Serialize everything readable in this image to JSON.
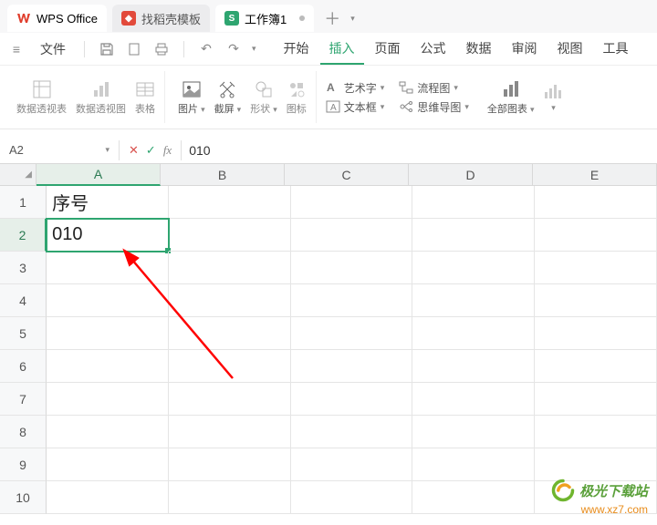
{
  "tabs": {
    "wps": "WPS Office",
    "t1": "找稻壳模板",
    "t2": "工作簿1"
  },
  "menu": {
    "file": "文件",
    "items": [
      "开始",
      "插入",
      "页面",
      "公式",
      "数据",
      "审阅",
      "视图",
      "工具"
    ],
    "activeIndex": 1
  },
  "ribbon": {
    "pivotTable": "数据透视表",
    "pivotChart": "数据透视图",
    "table": "表格",
    "picture": "图片",
    "screenshot": "截屏",
    "shapes": "形状",
    "icons": "图标",
    "wordart": "艺术字",
    "textbox": "文本框",
    "flowchart": "流程图",
    "mindmap": "思维导图",
    "allcharts": "全部图表"
  },
  "namebox": "A2",
  "formula_value": "010",
  "columns": [
    "A",
    "B",
    "C",
    "D",
    "E"
  ],
  "rows_count": 10,
  "cells": {
    "A1": "序号",
    "A2": "010"
  },
  "selected": "A2",
  "watermark": {
    "name": "极光下载站",
    "url": "www.xz7.com"
  },
  "glyph": {
    "hamburger": "≡",
    "save": "🖫",
    "print": "⎙",
    "undo": "↶",
    "redo": "↷",
    "dropdown": "▾",
    "plus": "＋",
    "check": "✓",
    "cross": "✕",
    "pin": "📌",
    "corner": "◢"
  }
}
